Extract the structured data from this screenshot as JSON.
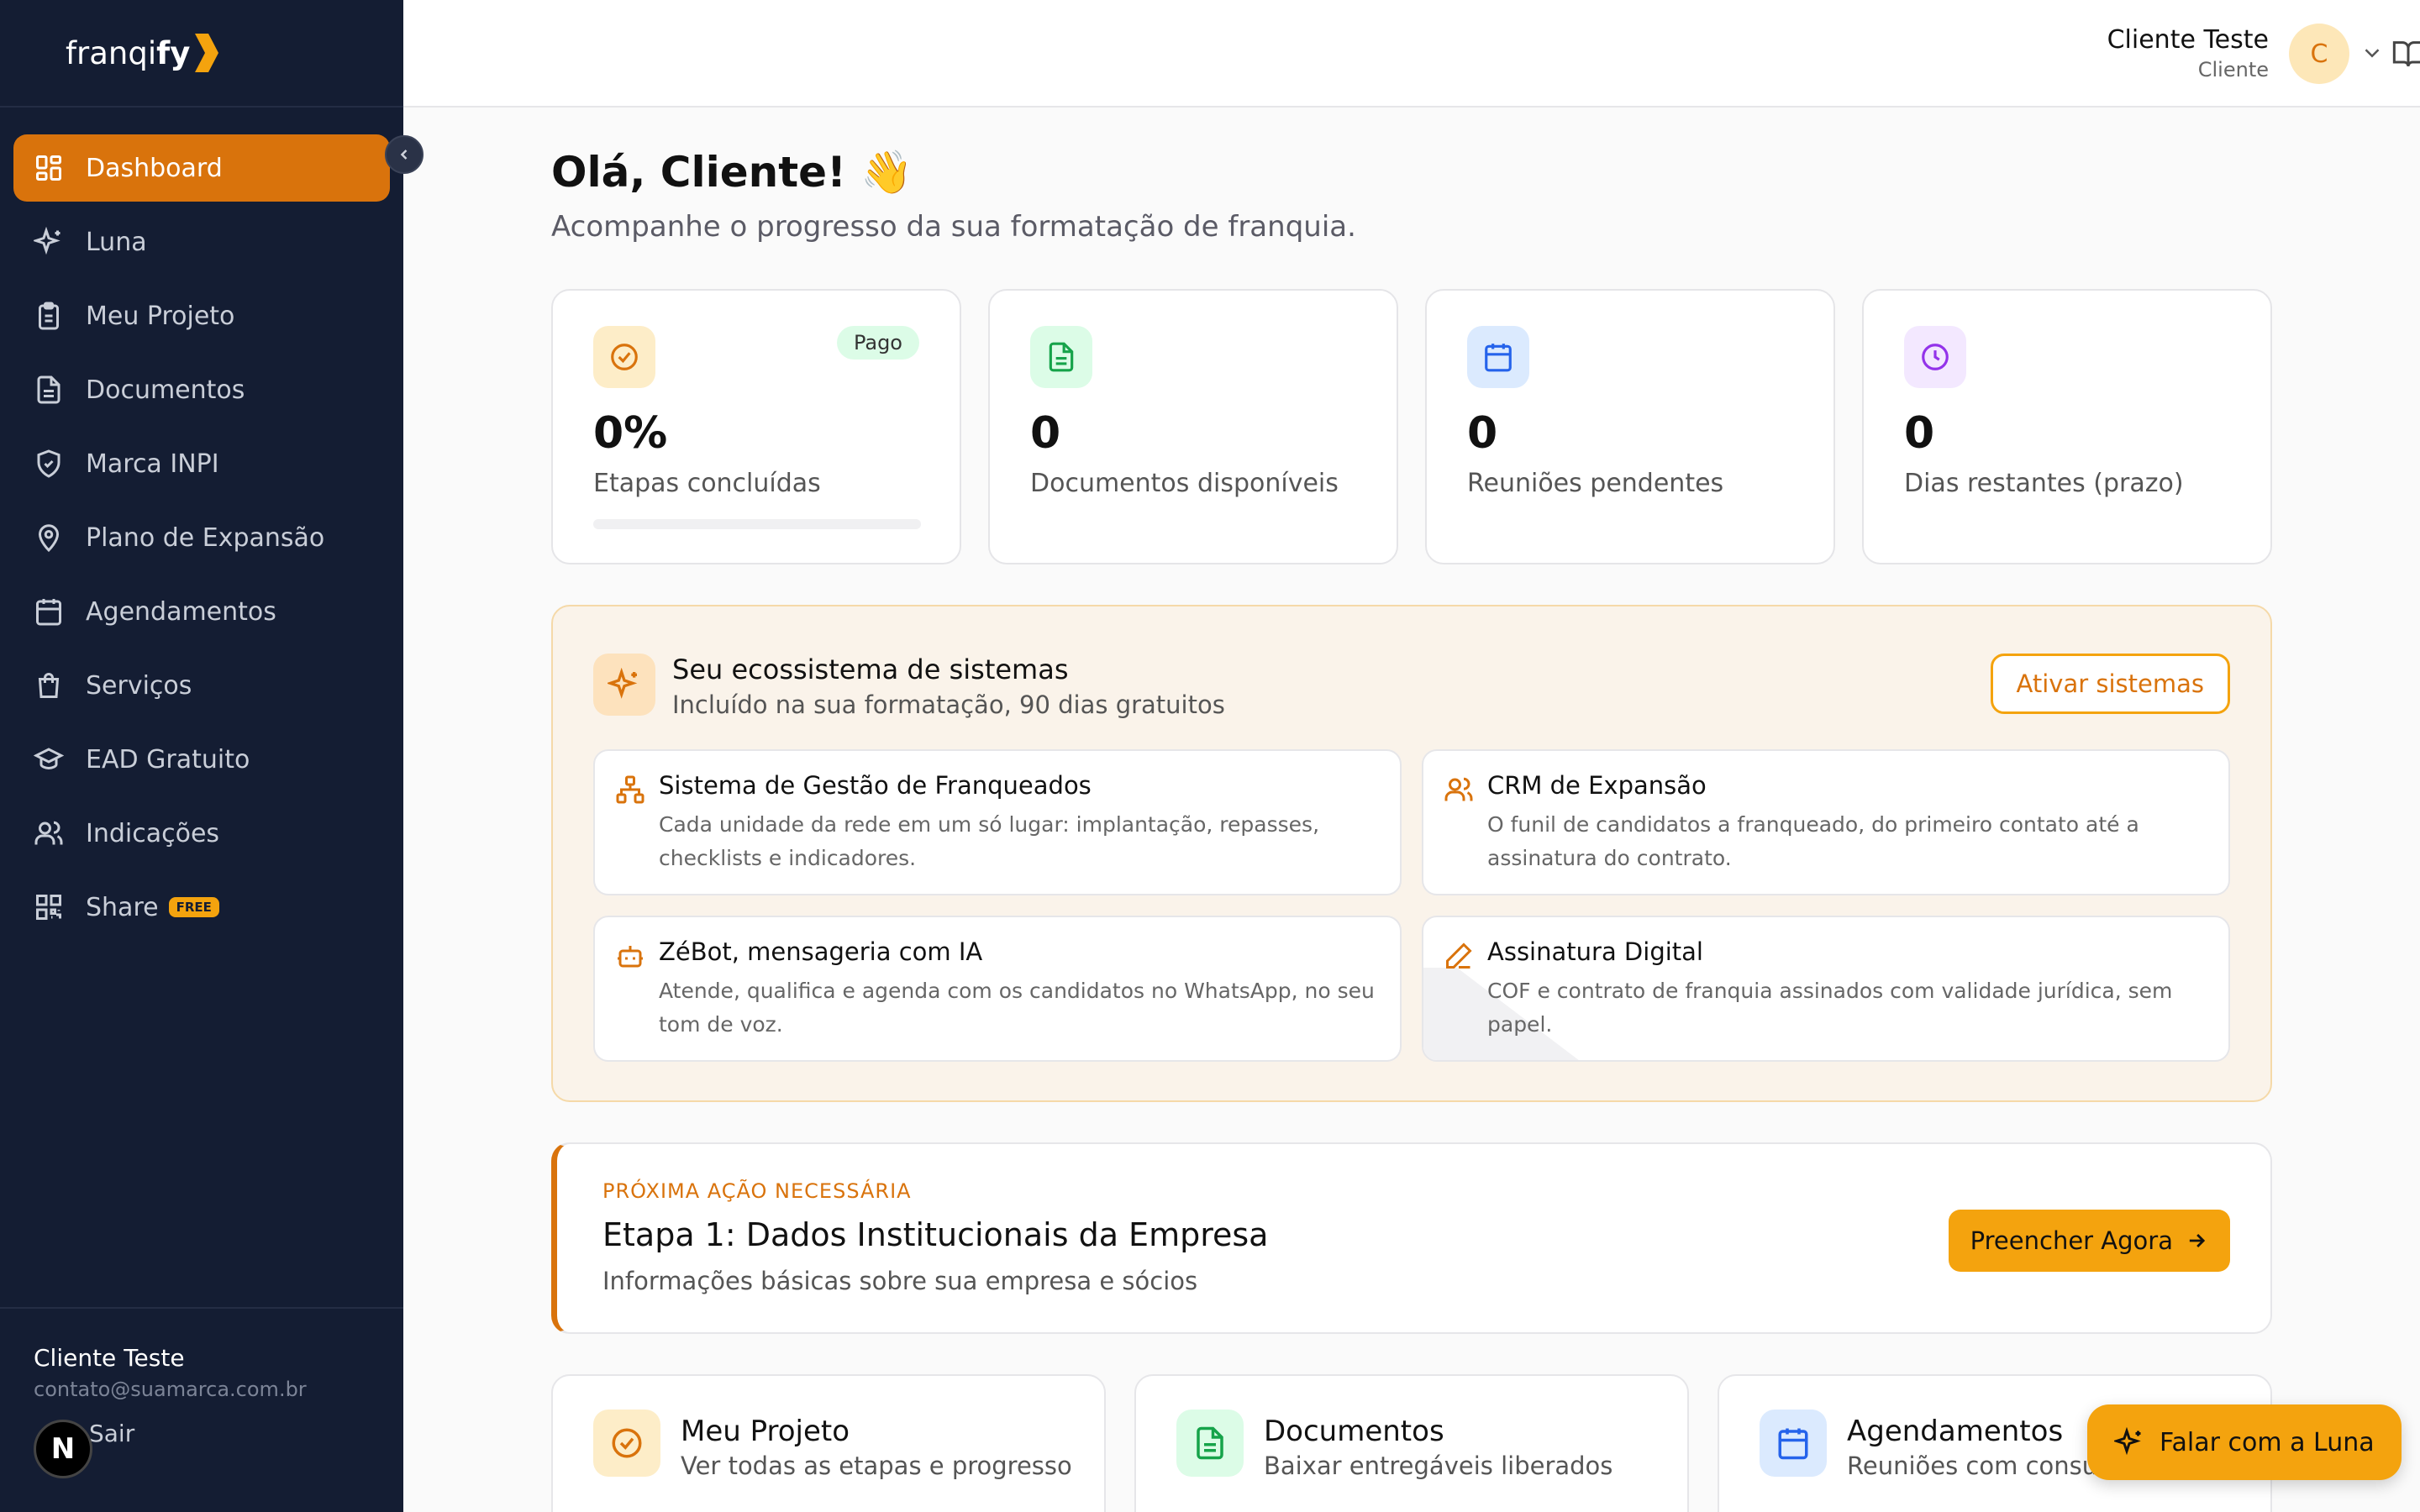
{
  "brand": {
    "logo_text_light": "franqi",
    "logo_text_bold": "fy"
  },
  "sidebar": {
    "items": [
      {
        "label": "Dashboard",
        "icon": "dashboard-grid-icon",
        "active": true
      },
      {
        "label": "Luna",
        "icon": "sparkles-icon"
      },
      {
        "label": "Meu Projeto",
        "icon": "clipboard-icon"
      },
      {
        "label": "Documentos",
        "icon": "document-icon"
      },
      {
        "label": "Marca INPI",
        "icon": "shield-check-icon"
      },
      {
        "label": "Plano de Expansão",
        "icon": "map-pin-icon"
      },
      {
        "label": "Agendamentos",
        "icon": "calendar-icon"
      },
      {
        "label": "Serviços",
        "icon": "shopping-bag-icon"
      },
      {
        "label": "EAD Gratuito",
        "icon": "graduation-cap-icon"
      },
      {
        "label": "Indicações",
        "icon": "users-icon"
      },
      {
        "label": "Share",
        "icon": "qr-code-icon",
        "badge": "FREE"
      }
    ],
    "user": {
      "name": "Cliente Teste",
      "email": "contato@suamarca.com.br"
    },
    "logout_label": "Sair",
    "n_badge": "N"
  },
  "header": {
    "user_name": "Cliente Teste",
    "user_role": "Cliente",
    "avatar_initial": "C"
  },
  "main": {
    "greeting": "Olá, Cliente! 👋",
    "subtitle": "Acompanhe o progresso da sua formatação de franquia.",
    "stats": [
      {
        "value": "0%",
        "label": "Etapas concluídas",
        "badge": "Pago",
        "progress": 0,
        "icon": "check-circle-icon"
      },
      {
        "value": "0",
        "label": "Documentos disponíveis",
        "icon": "document-icon"
      },
      {
        "value": "0",
        "label": "Reuniões pendentes",
        "icon": "calendar-icon"
      },
      {
        "value": "0",
        "label": "Dias restantes (prazo)",
        "icon": "clock-icon"
      }
    ],
    "ecosystem": {
      "title": "Seu ecossistema de sistemas",
      "subtitle": "Incluído na sua formatação, 90 dias gratuitos",
      "button": "Ativar sistemas",
      "systems": [
        {
          "title": "Sistema de Gestão de Franqueados",
          "desc": "Cada unidade da rede em um só lugar: implantação, repasses, checklists e indicadores.",
          "icon": "network-icon"
        },
        {
          "title": "CRM de Expansão",
          "desc": "O funil de candidatos a franqueado, do primeiro contato até a assinatura do contrato.",
          "icon": "users-icon"
        },
        {
          "title": "ZéBot, mensageria com IA",
          "desc": "Atende, qualifica e agenda com os candidatos no WhatsApp, no seu tom de voz.",
          "icon": "bot-icon"
        },
        {
          "title": "Assinatura Digital",
          "desc": "COF e contrato de franquia assinados com validade jurídica, sem papel.",
          "icon": "pen-icon"
        }
      ]
    },
    "next_action": {
      "eyebrow": "PRÓXIMA AÇÃO NECESSÁRIA",
      "title": "Etapa 1: Dados Institucionais da Empresa",
      "desc": "Informações básicas sobre sua empresa e sócios",
      "button": "Preencher Agora"
    },
    "quick_links": [
      {
        "title": "Meu Projeto",
        "desc": "Ver todas as etapas e progresso",
        "icon": "check-circle-icon"
      },
      {
        "title": "Documentos",
        "desc": "Baixar entregáveis liberados",
        "icon": "document-icon"
      },
      {
        "title": "Agendamentos",
        "desc": "Reuniões com consultoria",
        "icon": "calendar-icon"
      }
    ],
    "fab": "Falar com a Luna"
  },
  "colors": {
    "accent": "#f4a30e",
    "accent_dark": "#d9730c",
    "sidebar_bg": "#141d33"
  }
}
